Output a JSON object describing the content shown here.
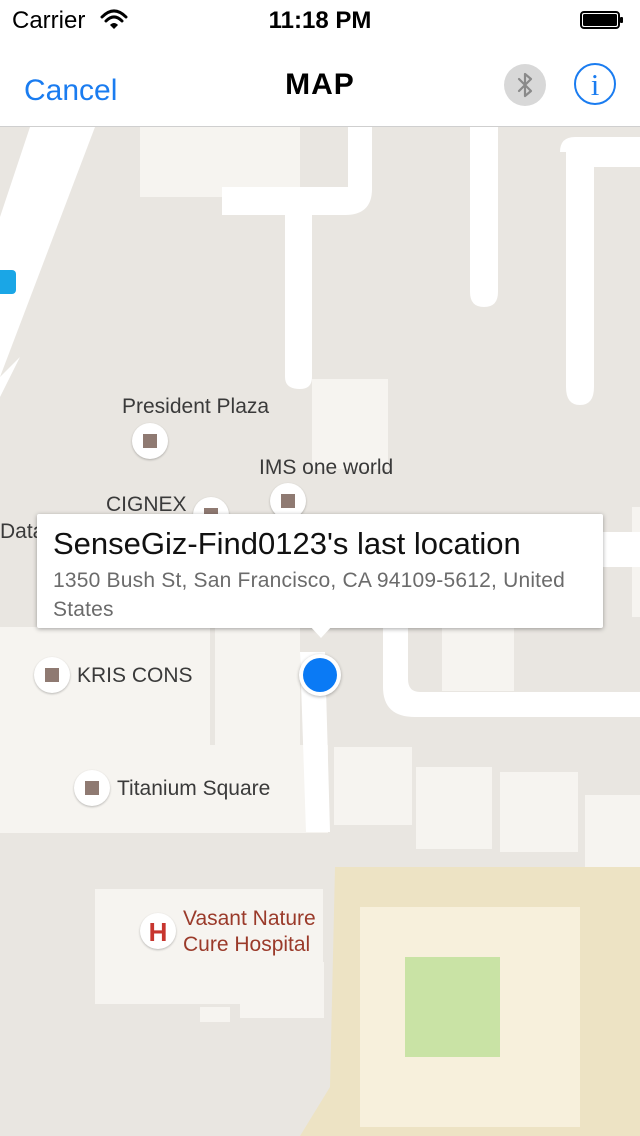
{
  "status_bar": {
    "carrier": "Carrier",
    "time": "11:18 PM"
  },
  "nav_bar": {
    "cancel_label": "Cancel",
    "title": "MAP",
    "bluetooth_icon": "bluetooth-icon",
    "info_icon": "info-icon",
    "info_glyph": "i"
  },
  "map": {
    "pois": [
      {
        "label": "President Plaza"
      },
      {
        "label": "IMS one world"
      },
      {
        "label": "CIGNEX"
      },
      {
        "label": "Data"
      },
      {
        "label": "KRIS CONS"
      },
      {
        "label": "Titanium Square"
      }
    ],
    "hospital": {
      "line1": "Vasant Nature",
      "line2": "Cure Hospital",
      "icon_glyph": "H"
    },
    "callout": {
      "title": "SenseGiz-Find0123's last location",
      "address": "1350 Bush St, San Francisco, CA 94109-5612, United States"
    }
  },
  "colors": {
    "accent": "#1a7cf0",
    "location_dot": "#0a7af5",
    "map_background": "#e9e6e1",
    "road": "#ffffff",
    "park": "#c9e3a5",
    "campus": "#ede3c4"
  }
}
